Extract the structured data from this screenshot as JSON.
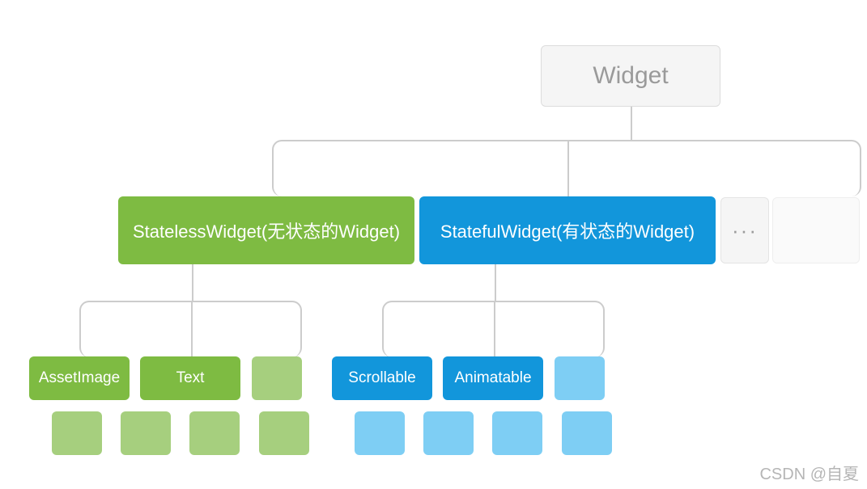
{
  "root": {
    "label": "Widget"
  },
  "stateless": {
    "label": "StatelessWidget(无状态的Widget)",
    "children": {
      "asset_image": "AssetImage",
      "text": "Text"
    }
  },
  "stateful": {
    "label": "StatefulWidget(有状态的Widget)",
    "children": {
      "scrollable": "Scrollable",
      "animatable": "Animatable"
    }
  },
  "more": {
    "label": "···"
  },
  "watermark": "CSDN @自夏",
  "colors": {
    "green": "#7ebb42",
    "green_light": "#a6cf7e",
    "blue": "#1296db",
    "blue_light": "#7ecef4",
    "gray_bg": "#f5f5f5",
    "gray_border": "#dcdcdc",
    "connector": "#cccccc"
  }
}
